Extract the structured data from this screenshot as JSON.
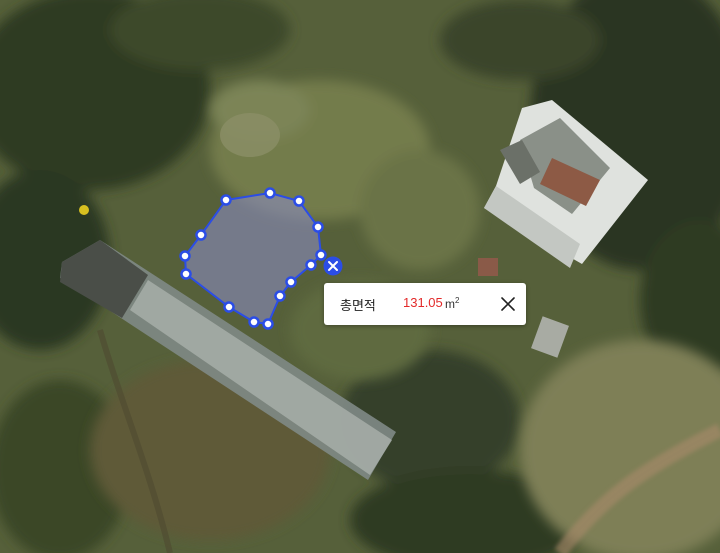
{
  "popup": {
    "label": "총면적",
    "value": "131.05",
    "unit": "m",
    "unit_sup": "2",
    "value_color": "#e32a2a"
  },
  "icons": {
    "close": "close-icon",
    "delete_vertex": "delete-x-icon"
  },
  "colors": {
    "polygon_stroke": "#2b4de6",
    "vertex_fill": "#ffffff",
    "vertex_stroke": "#2b4de6",
    "delete_fill": "#2b4de6"
  }
}
